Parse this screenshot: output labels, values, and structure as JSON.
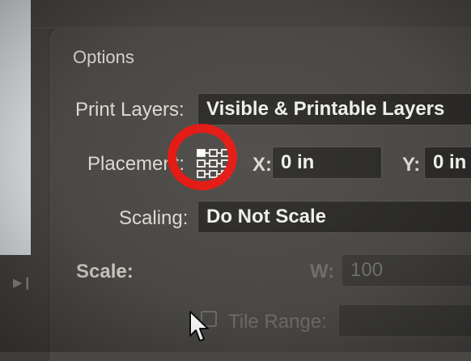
{
  "dialog": {
    "section_title": "Options",
    "print_layers": {
      "label": "Print Layers:",
      "value": "Visible & Printable Layers"
    },
    "placement": {
      "label": "Placement:",
      "x_label": "X:",
      "x_value": "0 in",
      "y_label": "Y:",
      "y_value": "0 in"
    },
    "scaling": {
      "label": "Scaling:",
      "value": "Do Not Scale"
    },
    "scale": {
      "label": "Scale:",
      "w_label": "W:",
      "w_value": "100"
    },
    "tile_range": {
      "label": "Tile Range:",
      "checked": false
    }
  },
  "annotation": {
    "highlight_color": "#e3150f"
  },
  "icons": [
    "reference-point-grid-icon",
    "play-icon",
    "mouse-pointer-icon"
  ]
}
